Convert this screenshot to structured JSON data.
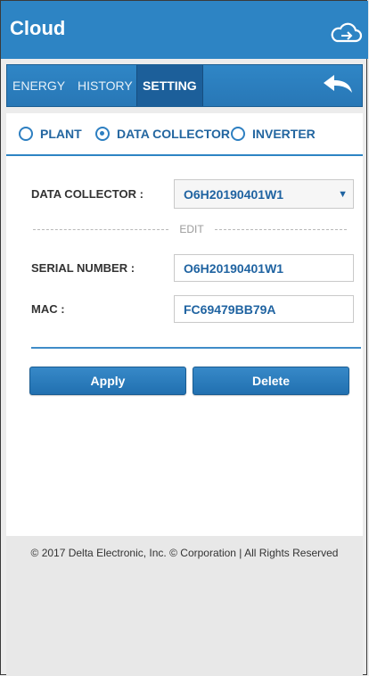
{
  "app": {
    "title": "Cloud"
  },
  "tabs": [
    {
      "label": "ENERGY",
      "active": false
    },
    {
      "label": "HISTORY",
      "active": false
    },
    {
      "label": "SETTING",
      "active": true
    }
  ],
  "radio_options": [
    {
      "label": "PLANT",
      "checked": false
    },
    {
      "label": "DATA COLLECTOR",
      "checked": true
    },
    {
      "label": "INVERTER",
      "checked": false
    }
  ],
  "form": {
    "data_collector_label": "DATA COLLECTOR :",
    "data_collector_value": "O6H20190401W1",
    "edit_label": "EDIT",
    "serial_label": "SERIAL NUMBER :",
    "serial_value": "O6H20190401W1",
    "mac_label": "MAC :",
    "mac_value": "FC69479BB79A"
  },
  "buttons": {
    "apply": "Apply",
    "delete": "Delete"
  },
  "footer": {
    "text": "© 2017 Delta Electronic, Inc. © Corporation | All Rights Reserved"
  },
  "icons": {
    "cloud": "cloud-upload-icon",
    "back": "back-arrow-icon",
    "dropdown": "triangle-down-icon"
  },
  "colors": {
    "primary": "#2d84c4",
    "dark_tab": "#1c5f9a",
    "accent_text": "#1f63a1"
  }
}
